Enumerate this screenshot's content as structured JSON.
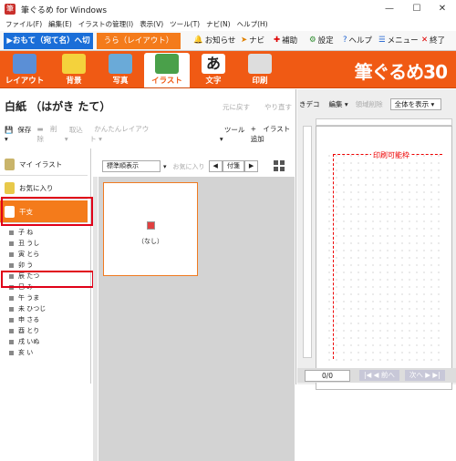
{
  "window": {
    "title": "筆ぐるめ for Windows",
    "minimize": "—",
    "maximize": "☐",
    "close": "✕"
  },
  "menu": [
    "ファイル(F)",
    "編集(E)",
    "イラストの管理(I)",
    "表示(V)",
    "ツール(T)",
    "ナビ(N)",
    "ヘルプ(H)"
  ],
  "modes": {
    "front": "▶おもて（宛て名）へ切替",
    "back": "うら（レイアウト）"
  },
  "tools": {
    "news": "お知らせ",
    "navi": "ナビ",
    "hosoku": "補助",
    "settings": "設定",
    "help": "ヘルプ",
    "menu": "メニュー",
    "exit": "終了"
  },
  "ribbon": {
    "items": [
      "レイアウト",
      "背景",
      "写真",
      "イラスト",
      "文字",
      "印刷"
    ],
    "brand": "筆ぐるめ30"
  },
  "doc": {
    "title": "白紙 （はがき たて）",
    "undo": "元に戻す",
    "redo": "やり直す"
  },
  "toolbar": {
    "save": "保存",
    "delete": "削除",
    "import": "取込",
    "easy_layout": "かんたんレイアウト",
    "tool": "ツール",
    "add_illust": "イラスト追加"
  },
  "categories": {
    "my_illust": "マイ イラスト",
    "favorites": "お気に入り",
    "eto": "干支"
  },
  "eto_list": [
    "子 ね",
    "丑 うし",
    "寅 とら",
    "卯 う",
    "辰 たつ",
    "巳 み",
    "午 うま",
    "未 ひつじ",
    "申 さる",
    "酉 とり",
    "戌 いぬ",
    "亥 い"
  ],
  "filter": {
    "sort": "標準順表示",
    "fav": "お気に入り",
    "tag": "付箋"
  },
  "card": {
    "label": "（なし）"
  },
  "right": {
    "tab": "きデコ",
    "edit": "編集",
    "range_delete": "領域削除",
    "zoom": "全体を表示",
    "print_area": "印刷可能枠"
  },
  "status": {
    "page": "0/0",
    "prev": "|◀ ◀ 前へ",
    "next": "次へ ▶ ▶|"
  }
}
